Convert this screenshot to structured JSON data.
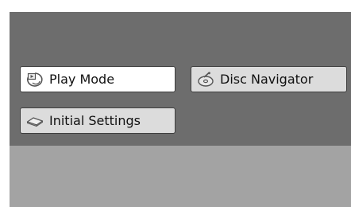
{
  "menu": {
    "items": [
      {
        "label": "Play Mode",
        "icon": "play-mode-icon",
        "selected": true
      },
      {
        "label": "Disc Navigator",
        "icon": "disc-navigator-icon",
        "selected": false
      },
      {
        "label": "Initial Settings",
        "icon": "initial-settings-icon",
        "selected": false
      }
    ]
  },
  "colors": {
    "panel": "#6d6d6d",
    "screen": "#a3a3a3",
    "selected_button": "#ffffff",
    "button": "#dcdcdc"
  }
}
